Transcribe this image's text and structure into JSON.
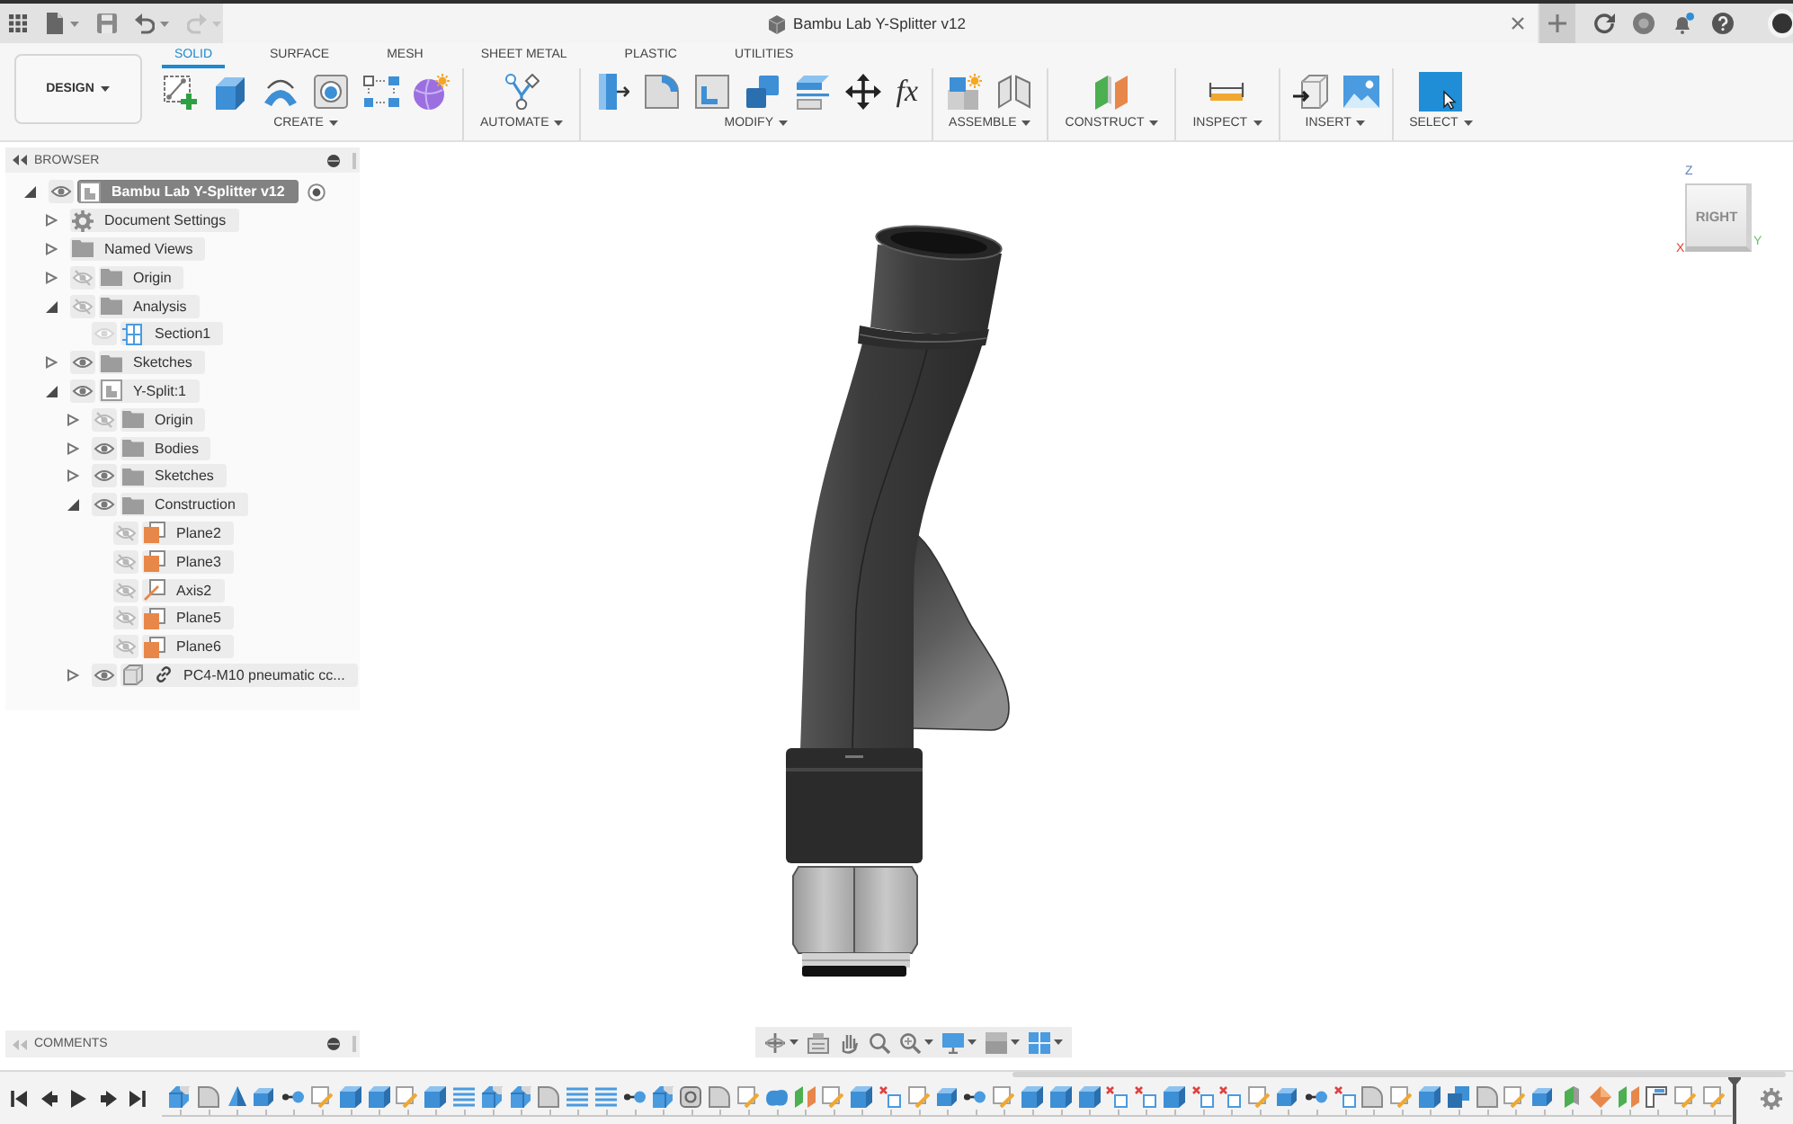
{
  "app_bar": {
    "quick_access": [
      {
        "kind": "file",
        "dropdown": true,
        "disabled": false
      },
      {
        "kind": "save",
        "dropdown": false,
        "disabled": false
      },
      {
        "kind": "undo",
        "dropdown": true,
        "disabled": false
      },
      {
        "kind": "redo",
        "dropdown": true,
        "disabled": true
      }
    ],
    "document_tab": {
      "title": "Bambu Lab Y-Splitter v12"
    }
  },
  "ribbon": {
    "workspace": "DESIGN",
    "tabs": [
      {
        "label": "SOLID",
        "selected": true
      },
      {
        "label": "SURFACE",
        "selected": false
      },
      {
        "label": "MESH",
        "selected": false
      },
      {
        "label": "SHEET METAL",
        "selected": false
      },
      {
        "label": "PLASTIC",
        "selected": false
      },
      {
        "label": "UTILITIES",
        "selected": false
      }
    ],
    "groups": [
      {
        "label": "CREATE",
        "tools": [
          {
            "kind": "sketch"
          },
          {
            "kind": "extrude"
          },
          {
            "kind": "sweep"
          },
          {
            "kind": "hole"
          },
          {
            "kind": "pattern"
          },
          {
            "kind": "form"
          }
        ]
      },
      {
        "label": "AUTOMATE",
        "tools": [
          {
            "kind": "automate"
          }
        ]
      },
      {
        "label": "MODIFY",
        "tools": [
          {
            "kind": "presspull"
          },
          {
            "kind": "fillet"
          },
          {
            "kind": "shell"
          },
          {
            "kind": "combine"
          },
          {
            "kind": "split"
          },
          {
            "kind": "move"
          },
          {
            "kind": "glyph",
            "glyph": "fx"
          }
        ]
      },
      {
        "label": "ASSEMBLE",
        "tools": [
          {
            "kind": "component"
          },
          {
            "kind": "joint"
          }
        ]
      },
      {
        "label": "CONSTRUCT",
        "tools": [
          {
            "kind": "plane"
          }
        ]
      },
      {
        "label": "INSPECT",
        "tools": [
          {
            "kind": "measure"
          }
        ]
      },
      {
        "label": "INSERT",
        "tools": [
          {
            "kind": "insert"
          },
          {
            "kind": "image"
          }
        ]
      },
      {
        "label": "SELECT",
        "tools": [
          {
            "kind": "select"
          }
        ]
      }
    ]
  },
  "browser": {
    "title": "BROWSER",
    "tree": [
      {
        "label": "Bambu Lab Y-Splitter v12",
        "kind": "component",
        "visible": true,
        "active": true,
        "expanded": true,
        "children": [
          {
            "label": "Document Settings",
            "kind": "settings",
            "active": false,
            "expanded": false
          },
          {
            "label": "Named Views",
            "kind": "folder",
            "active": false,
            "expanded": false
          },
          {
            "label": "Origin",
            "kind": "folder",
            "visible": false,
            "active": false,
            "expanded": false
          },
          {
            "label": "Analysis",
            "kind": "folder",
            "visible": false,
            "active": false,
            "expanded": true,
            "children": [
              {
                "label": "Section1",
                "kind": "section",
                "visible": true,
                "active": false
              }
            ]
          },
          {
            "label": "Sketches",
            "kind": "folder",
            "visible": true,
            "active": false,
            "expanded": false
          },
          {
            "label": "Y-Split:1",
            "kind": "component",
            "visible": true,
            "active": false,
            "expanded": true,
            "children": [
              {
                "label": "Origin",
                "kind": "folder",
                "visible": false,
                "active": false,
                "expanded": false
              },
              {
                "label": "Bodies",
                "kind": "folder",
                "visible": true,
                "active": false,
                "expanded": false
              },
              {
                "label": "Sketches",
                "kind": "folder",
                "visible": true,
                "active": false,
                "expanded": false
              },
              {
                "label": "Construction",
                "kind": "folder",
                "visible": true,
                "active": false,
                "expanded": true,
                "children": [
                  {
                    "label": "Plane2",
                    "kind": "plane",
                    "visible": false,
                    "active": false
                  },
                  {
                    "label": "Plane3",
                    "kind": "plane",
                    "visible": false,
                    "active": false
                  },
                  {
                    "label": "Axis2",
                    "kind": "axis",
                    "visible": false,
                    "active": false
                  },
                  {
                    "label": "Plane5",
                    "kind": "plane",
                    "visible": false,
                    "active": false
                  },
                  {
                    "label": "Plane6",
                    "kind": "plane",
                    "visible": false,
                    "active": false
                  }
                ]
              },
              {
                "label": "PC4-M10 pneumatic cc...",
                "kind": "linked-component",
                "visible": true,
                "active": false,
                "expanded": false
              }
            ]
          }
        ]
      }
    ]
  },
  "viewcube": {
    "face": "RIGHT",
    "axes": [
      {
        "label": "Z",
        "color": "#5b7fb5"
      },
      {
        "label": "X",
        "color": "#e03c31"
      },
      {
        "label": "Y",
        "color": "#6cbf6c"
      }
    ]
  },
  "comments": {
    "title": "COMMENTS"
  },
  "timeline": {
    "features": [
      {
        "kind": "cut"
      },
      {
        "kind": "round"
      },
      {
        "kind": "cone"
      },
      {
        "kind": "sweep"
      },
      {
        "kind": "joint"
      },
      {
        "kind": "sketch"
      },
      {
        "kind": "body"
      },
      {
        "kind": "body"
      },
      {
        "kind": "sketch"
      },
      {
        "kind": "body"
      },
      {
        "kind": "layers"
      },
      {
        "kind": "cut"
      },
      {
        "kind": "cut"
      },
      {
        "kind": "round"
      },
      {
        "kind": "layers"
      },
      {
        "kind": "layers"
      },
      {
        "kind": "joint"
      },
      {
        "kind": "cut"
      },
      {
        "kind": "hole"
      },
      {
        "kind": "round"
      },
      {
        "kind": "sketch"
      },
      {
        "kind": "blob"
      },
      {
        "kind": "plane"
      },
      {
        "kind": "sketch"
      },
      {
        "kind": "body"
      },
      {
        "kind": "split"
      },
      {
        "kind": "sketch"
      },
      {
        "kind": "sweep"
      },
      {
        "kind": "joint"
      },
      {
        "kind": "sketch"
      },
      {
        "kind": "body"
      },
      {
        "kind": "body"
      },
      {
        "kind": "body"
      },
      {
        "kind": "split"
      },
      {
        "kind": "split"
      },
      {
        "kind": "body"
      },
      {
        "kind": "split"
      },
      {
        "kind": "split"
      },
      {
        "kind": "sketch"
      },
      {
        "kind": "sweep"
      },
      {
        "kind": "joint"
      },
      {
        "kind": "split"
      },
      {
        "kind": "round"
      },
      {
        "kind": "sketch"
      },
      {
        "kind": "body"
      },
      {
        "kind": "combine"
      },
      {
        "kind": "round"
      },
      {
        "kind": "sketch"
      },
      {
        "kind": "sweep"
      },
      {
        "kind": "halfplane"
      },
      {
        "kind": "move"
      },
      {
        "kind": "plane"
      },
      {
        "kind": "bracket"
      },
      {
        "kind": "sketch"
      },
      {
        "kind": "sketch"
      }
    ]
  }
}
